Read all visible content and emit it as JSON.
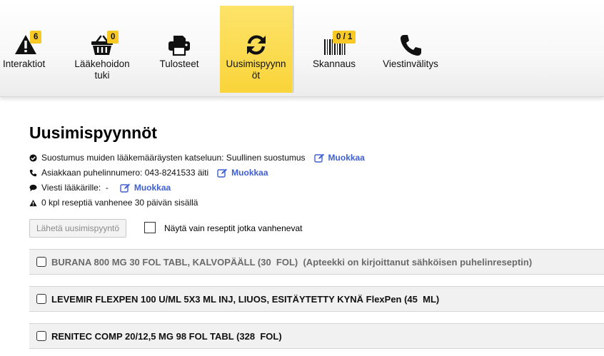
{
  "toolbar": {
    "items": [
      {
        "label": "Interaktiot",
        "badge": "6"
      },
      {
        "label": "Lääkehoidon tuki",
        "badge": "0"
      },
      {
        "label": "Tulosteet"
      },
      {
        "label": "Uusimispyynnöt"
      },
      {
        "label": "Skannaus",
        "badge": "0 / 1"
      },
      {
        "label": "Viestinvälitys"
      }
    ],
    "active_color": "#f9d43a",
    "badge_color": "#f8c824"
  },
  "page": {
    "title": "Uusimispyynnöt",
    "consent": "Suostumus muiden lääkemääräysten katseluun: Suullinen suostumus",
    "phone": "Asiakkaan puhelinnumero: 043-8241533 äiti",
    "message": "Viesti lääkärille:  -",
    "warning": "0 kpl reseptiä vanhenee 30 päivän sisällä",
    "edit_label": "Muokkaa",
    "link_color": "#3f5fd1"
  },
  "actions": {
    "send_button": "Lähetä uusimispyyntö",
    "filter_label": "Näytä vain reseptit jotka vanhenevat"
  },
  "prescriptions": [
    {
      "text": "BURANA 800 MG 30 FOL TABL, KALVOPÄÄLL (30  FOL)  (Apteekki on kirjoittanut sähköisen puhelinreseptin)"
    },
    {
      "text": "LEVEMIR FLEXPEN 100 U/ML 5X3 ML INJ, LIUOS, ESITÄYTETTY KYNÄ FlexPen (45  ML)"
    },
    {
      "text": "RENITEC COMP 20/12,5 MG 98 FOL TABL (328  FOL)"
    }
  ]
}
